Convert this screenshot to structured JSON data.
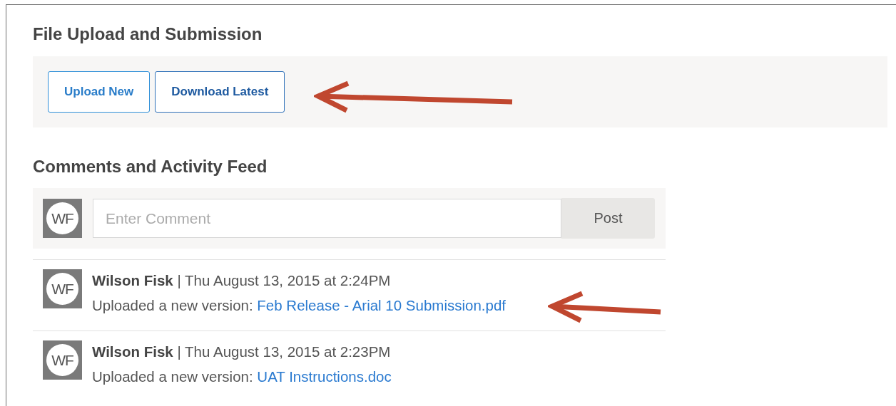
{
  "upload": {
    "title": "File Upload and Submission",
    "buttons": [
      {
        "label": "Upload New",
        "kind": "primary"
      },
      {
        "label": "Download Latest",
        "kind": "secondary"
      }
    ]
  },
  "comments": {
    "title": "Comments and Activity Feed",
    "avatar": "WF",
    "placeholder": "Enter Comment",
    "post": "Post"
  },
  "feed": [
    {
      "avatar": "WF",
      "header": "**Wilson Fisk** | Thu August 13, 2015 at 2:24PM",
      "action": "Uploaded a new version:",
      "file": "Feb Release - Arial 10 Submission.pdf"
    },
    {
      "avatar": "WF",
      "header": "**Wilson Fisk** | Thu August 13, 2015 at 2:23PM",
      "action": "Uploaded a new version:",
      "file": "UAT Instructions.doc"
    }
  ],
  "callouts": [
    {
      "kind": "arrow"
    },
    {
      "kind": "arrow"
    }
  ]
}
